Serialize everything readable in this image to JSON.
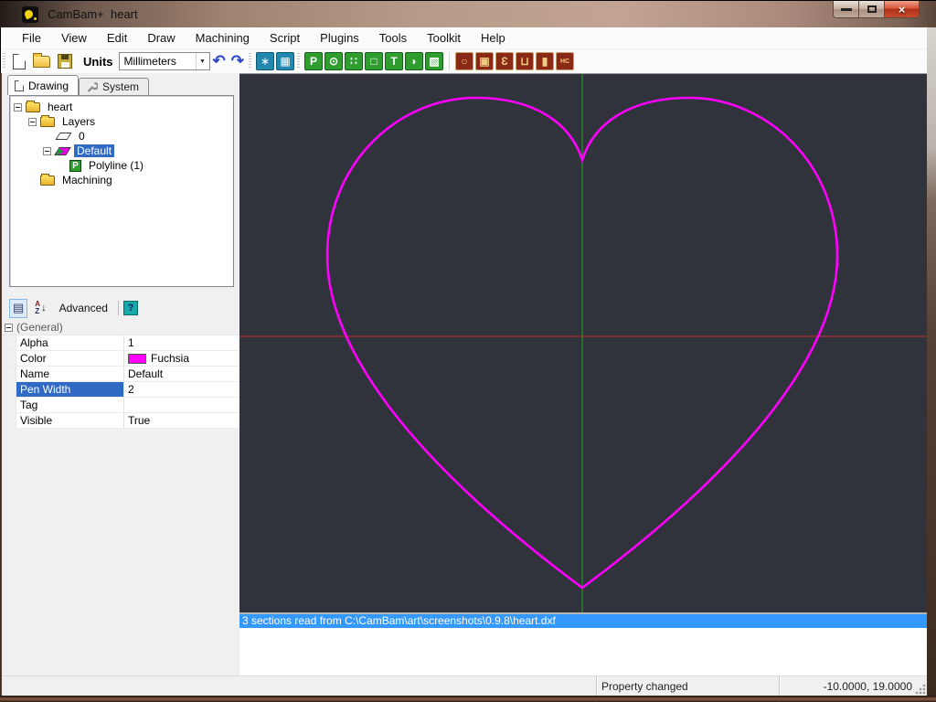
{
  "window": {
    "title": "CamBam+  heart",
    "minimize": "",
    "maximize": "",
    "close": "×"
  },
  "menu": {
    "items": [
      "File",
      "View",
      "Edit",
      "Draw",
      "Machining",
      "Script",
      "Plugins",
      "Tools",
      "Toolkit",
      "Help"
    ]
  },
  "toolbar": {
    "units_label": "Units",
    "units_value": "Millimeters",
    "combo_arrow": "▼",
    "undo": "↶",
    "redo": "↷",
    "snap_icons": [
      {
        "name": "snap-point-icon",
        "glyph": "∗"
      },
      {
        "name": "grid-icon",
        "glyph": "▦"
      }
    ],
    "draw_icons": [
      {
        "name": "polyline-icon",
        "glyph": "P"
      },
      {
        "name": "circle-icon",
        "glyph": "⊙"
      },
      {
        "name": "point-list-icon",
        "glyph": "∷"
      },
      {
        "name": "rectangle-icon",
        "glyph": "□"
      },
      {
        "name": "text-icon",
        "glyph": "T"
      },
      {
        "name": "arc-icon",
        "glyph": "◗"
      },
      {
        "name": "surface-icon",
        "glyph": "▧"
      }
    ],
    "cam_icons": [
      {
        "name": "profile-icon",
        "glyph": "○"
      },
      {
        "name": "pocket-icon",
        "glyph": "▣"
      },
      {
        "name": "engrave-icon",
        "glyph": "Ɛ"
      },
      {
        "name": "drill-icon",
        "glyph": "⊔"
      },
      {
        "name": "profile3d-icon",
        "glyph": "▮"
      },
      {
        "name": "gcode-icon",
        "glyph": "HC"
      }
    ]
  },
  "tabs": {
    "drawing": "Drawing",
    "system": "System"
  },
  "tree": {
    "items": [
      {
        "label": "heart"
      },
      {
        "label": "Layers"
      },
      {
        "label": "0"
      },
      {
        "label": "Default"
      },
      {
        "label": "Polyline (1)"
      },
      {
        "label": "Machining"
      }
    ]
  },
  "properties": {
    "toolbar": {
      "advanced_label": "Advanced",
      "help_label": "?"
    },
    "category": "(General)",
    "rows": [
      {
        "label": "Alpha",
        "value": "1"
      },
      {
        "label": "Color",
        "value": "Fuchsia",
        "swatch": "#ff00ff"
      },
      {
        "label": "Name",
        "value": "Default"
      },
      {
        "label": "Pen Width",
        "value": "2"
      },
      {
        "label": "Tag",
        "value": ""
      },
      {
        "label": "Visible",
        "value": "True"
      }
    ]
  },
  "canvas": {
    "bg": "#30333b",
    "heart_color": "#ff00ff",
    "axis_vertical_color": "#28a028",
    "axis_horizontal_color": "#cc2a2a"
  },
  "log": {
    "line1": "3 sections read from C:\\CamBam\\art\\screenshots\\0.9.8\\heart.dxf"
  },
  "statusbar": {
    "message": "Property changed",
    "coordinates": "-10.0000, 19.0000"
  }
}
